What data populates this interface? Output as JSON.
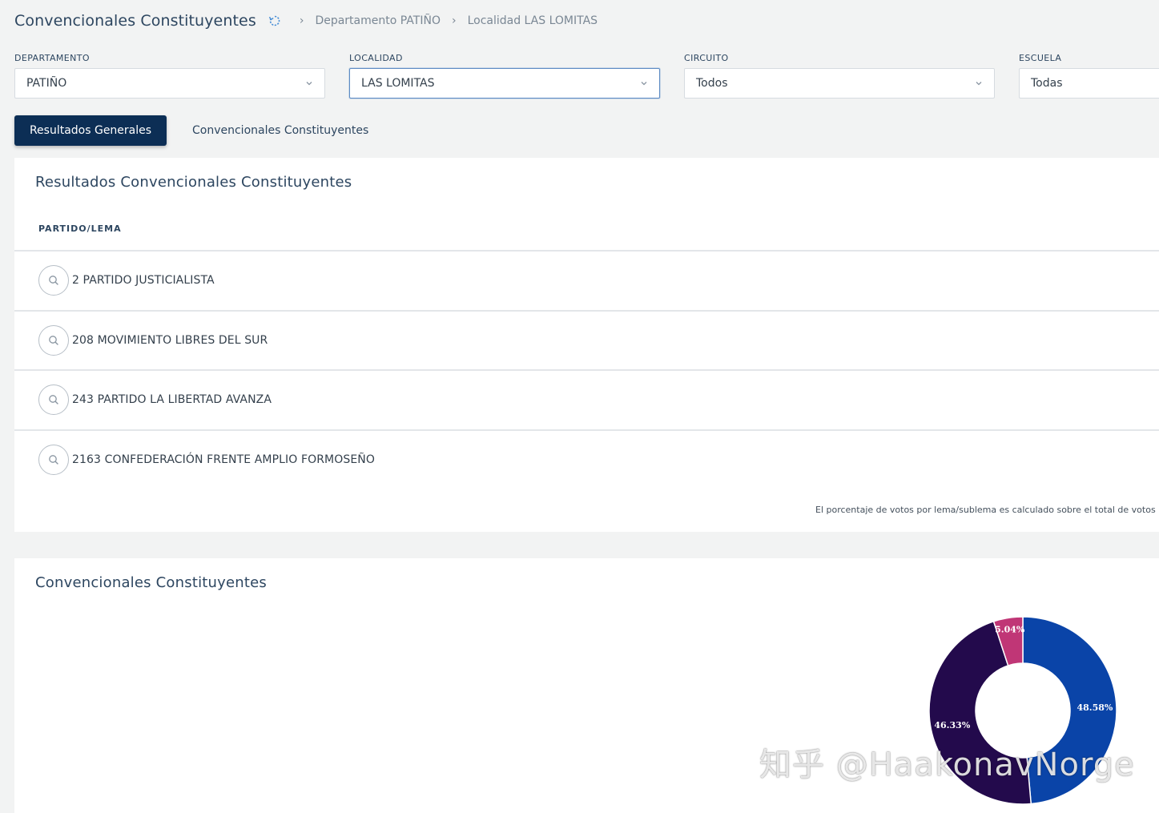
{
  "header": {
    "title": "Convencionales Constituyentes",
    "breadcrumbs": [
      "Departamento PATIÑO",
      "Localidad LAS LOMITAS"
    ]
  },
  "filters": {
    "departamento": {
      "label": "DEPARTAMENTO",
      "value": "PATIÑO"
    },
    "localidad": {
      "label": "LOCALIDAD",
      "value": "LAS LOMITAS"
    },
    "circuito": {
      "label": "CIRCUITO",
      "value": "Todos"
    },
    "escuela": {
      "label": "ESCUELA",
      "value": "Todas"
    }
  },
  "tabs": {
    "resultados": "Resultados Generales",
    "convencionales": "Convencionales Constituyentes"
  },
  "results": {
    "title": "Resultados Convencionales Constituyentes",
    "column_header": "PARTIDO/LEMA",
    "rows": [
      "2 PARTIDO JUSTICIALISTA",
      "208 MOVIMIENTO LIBRES DEL SUR",
      "243 PARTIDO LA LIBERTAD AVANZA",
      "2163 CONFEDERACIÓN FRENTE AMPLIO FORMOSEÑO"
    ],
    "footnote": "El porcentaje de votos por lema/sublema es calculado sobre el total de votos positivos"
  },
  "chart_section": {
    "title": "Convencionales Constituyentes"
  },
  "chart_data": {
    "type": "pie",
    "title": "",
    "slices": [
      {
        "label": "48.58%",
        "value": 48.58,
        "color": "#0a44a8"
      },
      {
        "label": "46.33%",
        "value": 46.33,
        "color": "#230a4c"
      },
      {
        "label": "5.04%",
        "value": 5.04,
        "color": "#c03676"
      }
    ],
    "start_angle_deg": 0,
    "donut": true
  },
  "watermark": "知乎 @HaakonavNorge",
  "colors": {
    "primary": "#0c2e55",
    "title": "#2d4660",
    "background": "#f2f3f3"
  }
}
